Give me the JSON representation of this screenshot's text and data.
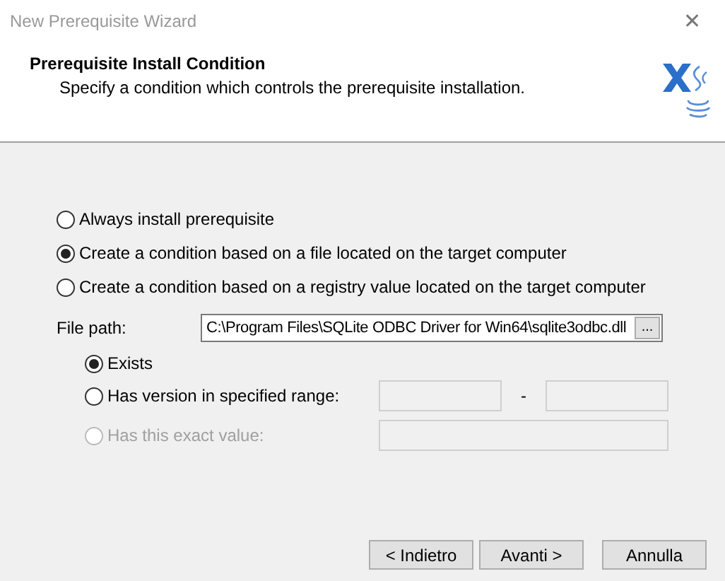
{
  "window": {
    "title": "New Prerequisite Wizard",
    "close": "✕"
  },
  "header": {
    "title": "Prerequisite Install Condition",
    "subtitle": "Specify a condition which controls the prerequisite installation."
  },
  "options": [
    {
      "label": "Always install prerequisite",
      "selected": false
    },
    {
      "label": "Create a condition based on a file located on the target computer",
      "selected": true
    },
    {
      "label": "Create a condition based on a registry value located on the target computer",
      "selected": false
    }
  ],
  "file_path": {
    "label": "File path:",
    "value": "C:\\Program Files\\SQLite ODBC Driver for Win64\\sqlite3odbc.dll",
    "browse": "..."
  },
  "sub_options": [
    {
      "kind": "plain",
      "label": "Exists",
      "selected": true,
      "disabled": false
    },
    {
      "kind": "range",
      "label": "Has version in specified range:",
      "separator": "-",
      "selected": false,
      "disabled": false
    },
    {
      "kind": "exact",
      "label": "Has this exact value:",
      "selected": false,
      "disabled": true
    }
  ],
  "buttons": [
    {
      "label": "< Indietro",
      "kind": "back"
    },
    {
      "label": "Avanti >",
      "kind": "next"
    },
    {
      "label": "Annulla",
      "kind": "cancel"
    }
  ]
}
